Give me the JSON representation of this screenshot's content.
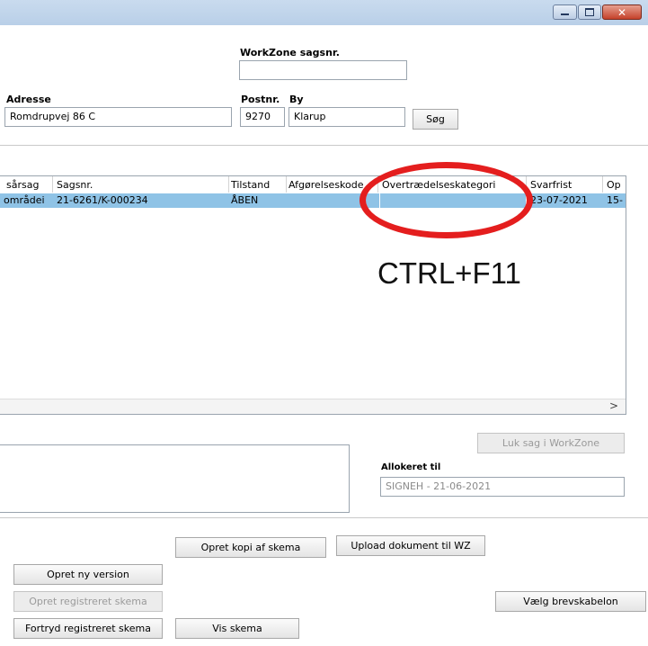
{
  "form": {
    "workzone_label": "WorkZone sagsnr.",
    "workzone_value": "",
    "adresse_label": "Adresse",
    "adresse_value": "Romdrupvej 86 C",
    "postnr_label": "Postnr.",
    "postnr_value": "9270",
    "by_label": "By",
    "by_value": "Klarup",
    "search_button": "Søg"
  },
  "grid": {
    "columns": [
      "sårsag",
      "Sagsnr.",
      "Tilstand",
      "Afgørelseskode",
      "Overtrædelseskategori",
      "Svarfrist",
      "Op"
    ],
    "rows": [
      [
        "områdei",
        "21-6261/K-000234",
        "ÅBEN",
        "",
        "",
        "23-07-2021",
        "15-"
      ]
    ],
    "scroll_right": ">"
  },
  "annotation": {
    "shortcut": "CTRL+F11",
    "ring_color": "#e41e1e"
  },
  "close_case_button": "Luk sag i WorkZone",
  "allocated": {
    "label": "Allokeret til",
    "value": "SIGNEH - 21-06-2021"
  },
  "buttons": {
    "copy_schema": "Opret kopi af skema",
    "upload_document": "Upload dokument til WZ",
    "new_version": "Opret ny version",
    "create_registered": "Opret registreret skema",
    "choose_letter_template": "Vælg brevskabelon",
    "undo_registered": "Fortryd registreret skema",
    "show_schema": "Vis skema"
  },
  "colors": {
    "selection": "#8fc3e6",
    "titlebar": "#c9dbee",
    "close_button": "#c5412a"
  },
  "icons": [
    "minimize-icon",
    "maximize-icon",
    "close-icon"
  ]
}
